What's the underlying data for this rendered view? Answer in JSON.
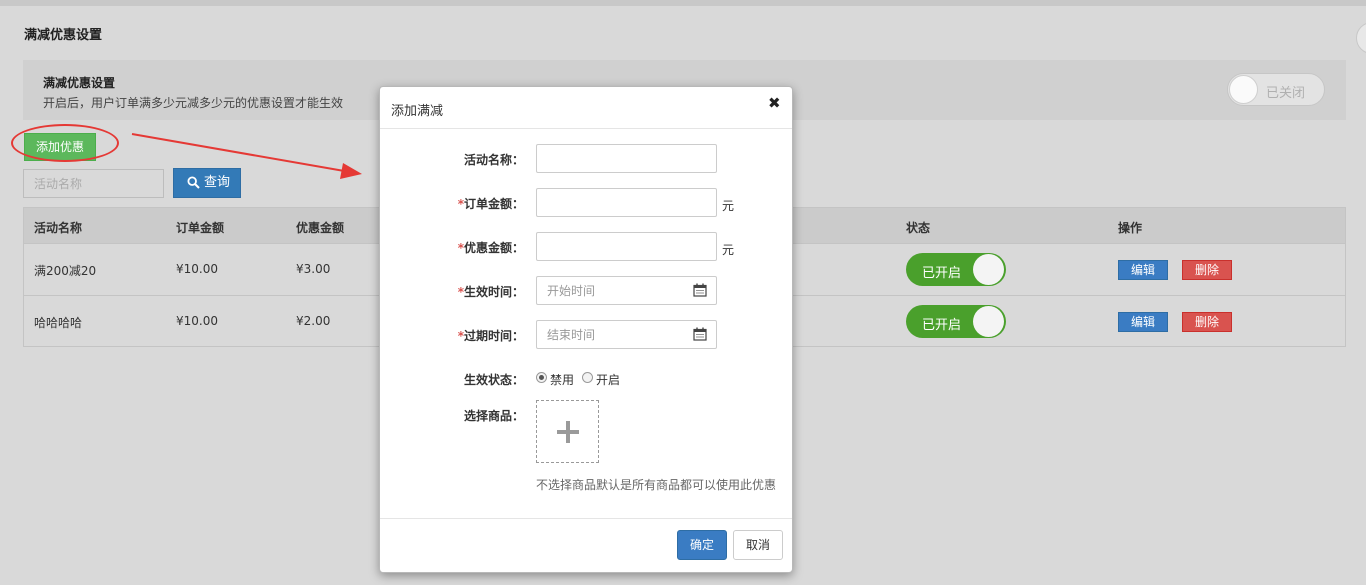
{
  "page": {
    "title": "满减优惠设置"
  },
  "setting": {
    "title": "满减优惠设置",
    "description": "开启后，用户订单满多少元减多少元的优惠设置才能生效",
    "toggle_label": "已关闭"
  },
  "toolbar": {
    "add_label": "添加优惠",
    "search_placeholder": "活动名称",
    "query_label": "查询"
  },
  "table": {
    "headers": {
      "name": "活动名称",
      "order_amount": "订单金额",
      "discount_amount": "优惠金额",
      "status": "状态",
      "actions": "操作"
    },
    "rows": [
      {
        "name": "满200减20",
        "order_amount": "¥10.00",
        "discount_amount": "¥3.00",
        "status": "已开启",
        "edit": "编辑",
        "delete": "删除"
      },
      {
        "name": "哈哈哈哈",
        "order_amount": "¥10.00",
        "discount_amount": "¥2.00",
        "status": "已开启",
        "edit": "编辑",
        "delete": "删除"
      }
    ]
  },
  "modal": {
    "title": "添加满减",
    "close": "✖",
    "fields": {
      "name": {
        "label": "活动名称：",
        "value": ""
      },
      "order_amount": {
        "required": "*",
        "label": "订单金额：",
        "value": "",
        "unit": "元"
      },
      "discount_amount": {
        "required": "*",
        "label": "优惠金额：",
        "value": "",
        "unit": "元"
      },
      "start_time": {
        "required": "*",
        "label": "生效时间：",
        "placeholder": "开始时间"
      },
      "end_time": {
        "required": "*",
        "label": "过期时间：",
        "placeholder": "结束时间"
      },
      "status": {
        "label": "生效状态：",
        "options": [
          "禁用",
          "开启"
        ],
        "selected": "禁用"
      },
      "products": {
        "label": "选择商品：",
        "hint": "不选择商品默认是所有商品都可以使用此优惠"
      }
    },
    "ok_label": "确定",
    "cancel_label": "取消"
  },
  "colors": {
    "primary": "#337ab7",
    "success": "#5cb85c",
    "danger": "#d9534f",
    "toggle_on": "#4aa02c",
    "annotation": "#e53935"
  }
}
